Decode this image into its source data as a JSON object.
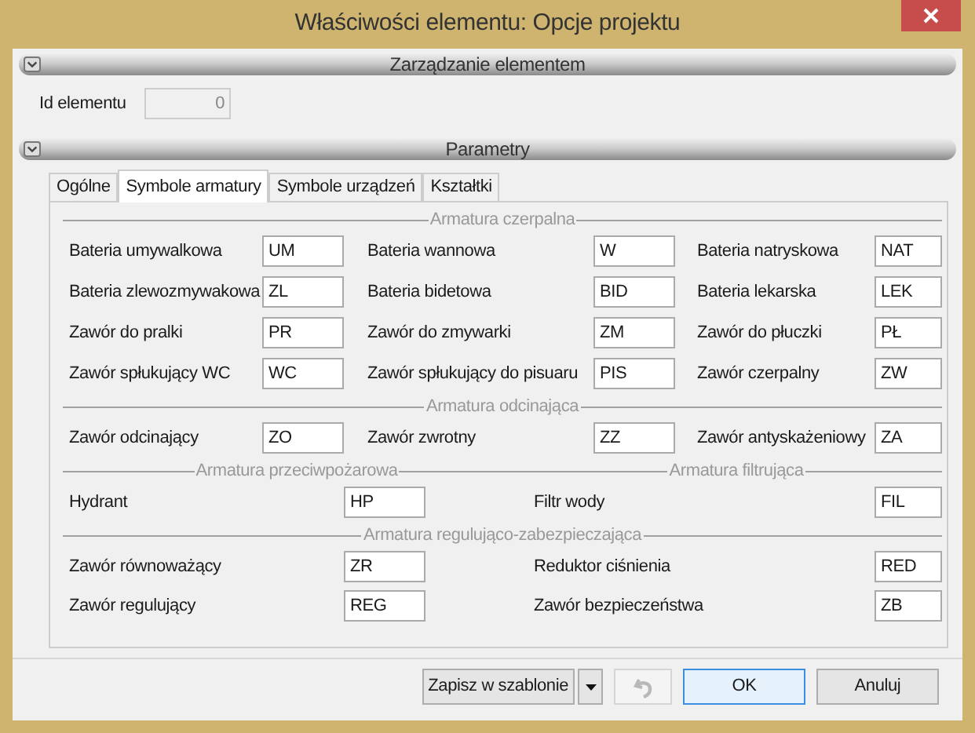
{
  "window": {
    "title": "Właściwości elementu: Opcje projektu"
  },
  "panels": [
    {
      "title": "Zarządzanie elementem",
      "expanded": true
    },
    {
      "title": "Parametry",
      "expanded": true
    }
  ],
  "element_id": {
    "label": "Id elementu",
    "value": "0",
    "disabled": true
  },
  "tabs": [
    {
      "label": "Ogólne",
      "selected": false
    },
    {
      "label": "Symbole armatury",
      "selected": true
    },
    {
      "label": "Symbole urządzeń",
      "selected": false
    },
    {
      "label": "Kształtki",
      "selected": false
    }
  ],
  "groups": [
    {
      "kind": "three_col",
      "titles": [
        "Armatura czerpalna"
      ],
      "fields": [
        {
          "label": "Bateria umywalkowa",
          "value": "UM"
        },
        {
          "label": "Bateria wannowa",
          "value": "W"
        },
        {
          "label": "Bateria natryskowa",
          "value": "NAT"
        },
        {
          "label": "Bateria zlewozmywakowa",
          "value": "ZL"
        },
        {
          "label": "Bateria bidetowa",
          "value": "BID"
        },
        {
          "label": "Bateria lekarska",
          "value": "LEK"
        },
        {
          "label": "Zawór do pralki",
          "value": "PR"
        },
        {
          "label": "Zawór do zmywarki",
          "value": "ZM"
        },
        {
          "label": "Zawór do płuczki",
          "value": "PŁ"
        },
        {
          "label": "Zawór spłukujący WC",
          "value": "WC"
        },
        {
          "label": "Zawór spłukujący do pisuaru",
          "value": "PIS"
        },
        {
          "label": "Zawór czerpalny",
          "value": "ZW"
        }
      ]
    },
    {
      "kind": "three_col",
      "titles": [
        "Armatura odcinająca"
      ],
      "fields": [
        {
          "label": "Zawór odcinający",
          "value": "ZO"
        },
        {
          "label": "Zawór zwrotny",
          "value": "ZZ"
        },
        {
          "label": "Zawór antyskażeniowy",
          "value": "ZA"
        }
      ]
    },
    {
      "kind": "two_col",
      "titles": [
        "Armatura przeciwpożarowa",
        "Armatura filtrująca"
      ],
      "fields": [
        {
          "label": "Hydrant",
          "value": "HP"
        },
        {
          "label": "Filtr wody",
          "value": "FIL"
        }
      ]
    },
    {
      "kind": "two_col",
      "titles": [
        "Armatura regulująco-zabezpieczająca"
      ],
      "fields": [
        {
          "label": "Zawór równoważący",
          "value": "ZR"
        },
        {
          "label": "Reduktor ciśnienia",
          "value": "RED"
        },
        {
          "label": "Zawór regulujący",
          "value": "REG"
        },
        {
          "label": "Zawór bezpieczeństwa",
          "value": "ZB"
        }
      ]
    }
  ],
  "footer": {
    "save_template": "Zapisz w szablonie",
    "undo_disabled": true,
    "ok": "OK",
    "cancel": "Anuluj"
  }
}
